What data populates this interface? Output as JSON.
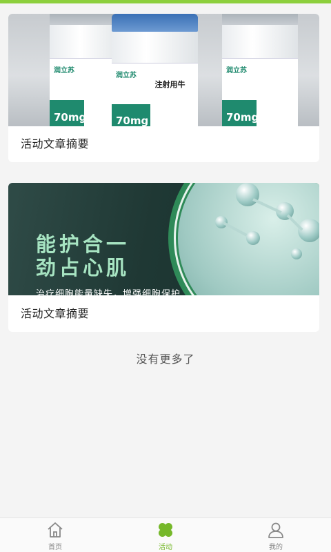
{
  "feed": {
    "items": [
      {
        "caption": "活动文章摘要",
        "image": {
          "brand": "润立苏",
          "product_name": "注射用牛",
          "dose": "70mg",
          "accent_color": "#1f8a6e"
        }
      },
      {
        "caption": "活动文章摘要",
        "image": {
          "headline_line1": "能护合一",
          "headline_line2": "劲占心肌",
          "subline": "治疗细胞能量缺失，增强细胞保护"
        }
      }
    ],
    "end_message": "没有更多了"
  },
  "tabbar": {
    "active_color": "#76b82a",
    "tabs": [
      {
        "label": "首页",
        "icon": "home-icon",
        "active": false
      },
      {
        "label": "活动",
        "icon": "clover-icon",
        "active": true
      },
      {
        "label": "我的",
        "icon": "user-icon",
        "active": false
      }
    ]
  }
}
